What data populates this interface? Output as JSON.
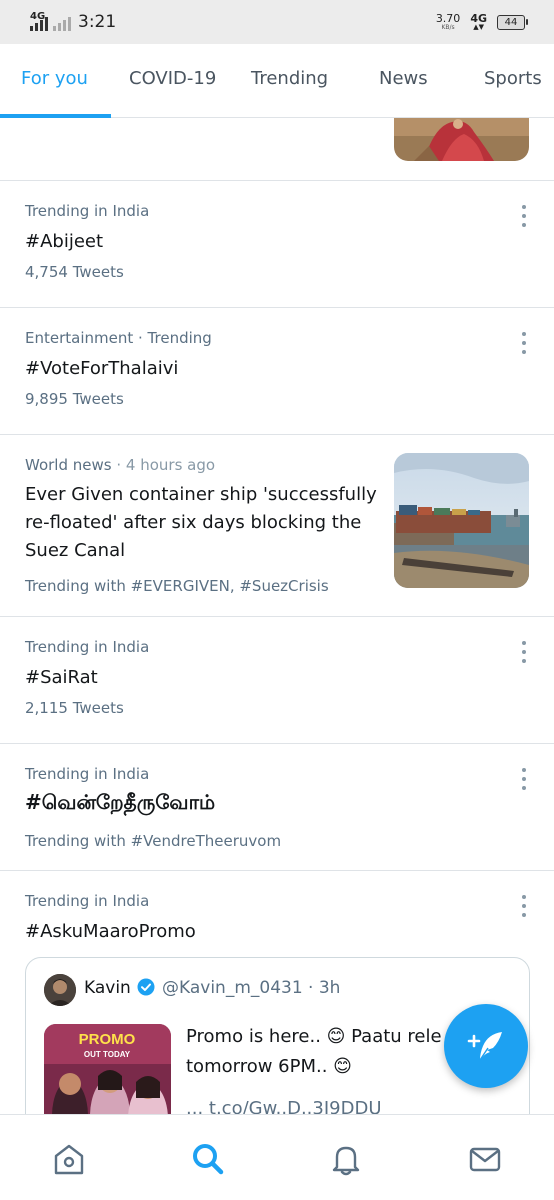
{
  "status_bar": {
    "network_left": "4G",
    "time": "3:21",
    "speed_value": "3.70",
    "speed_unit": "KB/s",
    "network_right": "4G",
    "battery": "44"
  },
  "tabs": [
    {
      "label": "For you",
      "active": true
    },
    {
      "label": "COVID-19",
      "active": false
    },
    {
      "label": "Trending",
      "active": false
    },
    {
      "label": "News",
      "active": false
    },
    {
      "label": "Sports",
      "active": false
    }
  ],
  "feed": {
    "trends": [
      {
        "meta": "Trending in India",
        "title": "#Abijeet",
        "count": "4,754 Tweets"
      },
      {
        "meta": "Entertainment · Trending",
        "title": "#VoteForThalaivi",
        "count": "9,895 Tweets"
      },
      {
        "meta": "Trending in India",
        "title": "#SaiRat",
        "count": "2,115 Tweets"
      },
      {
        "meta": "Trending in India",
        "title": "#வென்றேதீருவோம்",
        "count": "Trending with #VendreTheeruvom"
      },
      {
        "meta": "Trending in India",
        "title": "#AskuMaaroPromo"
      }
    ],
    "news": {
      "category": "World news",
      "time": "· 4 hours ago",
      "headline_lines": [
        "Ever Given container ship 'successfully",
        "re-floated' after six days blocking the",
        "Suez Canal"
      ],
      "trending_with": "Trending with #EVERGIVEN, #SuezCrisis"
    },
    "quote": {
      "name": "Kavin",
      "handle": "@Kavin_m_0431 · 3h",
      "text_lines": [
        "Promo is here.. 😊 Paatu rele",
        "tomorrow 6PM.. 😊",
        "... t.co/Gw..D..3I9DDU"
      ],
      "image_caption_1": "PROMO",
      "image_caption_2": "OUT TODAY"
    }
  },
  "colors": {
    "accent": "#1da1f2",
    "text_primary": "#14171a",
    "text_secondary": "#5b7083",
    "divider": "#dfe3e7"
  },
  "icons": {
    "fab": "compose-tweet-icon",
    "nav": [
      "home-icon",
      "search-icon",
      "notifications-icon",
      "messages-icon"
    ]
  }
}
